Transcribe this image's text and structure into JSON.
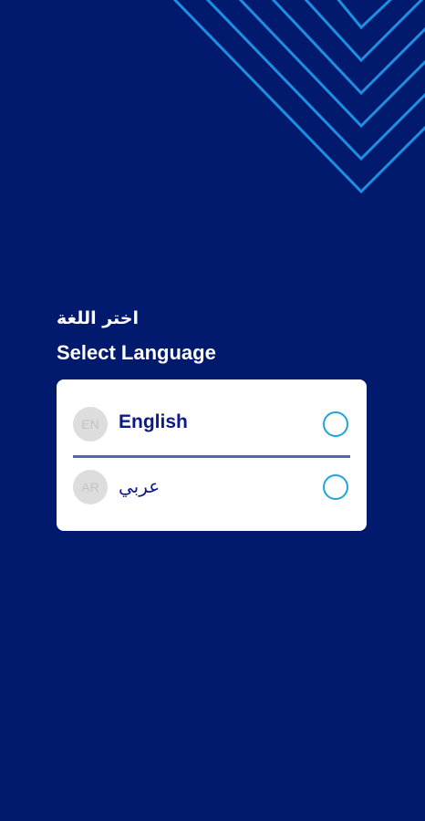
{
  "header": {
    "title_ar": "اختر اللغة",
    "title_en": "Select Language"
  },
  "languages": [
    {
      "badge": "EN",
      "label": "English",
      "selected": false
    },
    {
      "badge": "AR",
      "label": "عربي",
      "selected": false
    }
  ],
  "colors": {
    "background": "#021a6e",
    "decoration_stroke": "#1e8fe0",
    "card": "#ffffff",
    "label_text": "#0d1a86",
    "radio_border": "#1fa5d8",
    "divider": "#5a64ad",
    "badge_bg": "#dddddd"
  },
  "icons": {
    "decoration": "chevron-lines-decoration",
    "radio": "radio-unchecked-icon"
  }
}
